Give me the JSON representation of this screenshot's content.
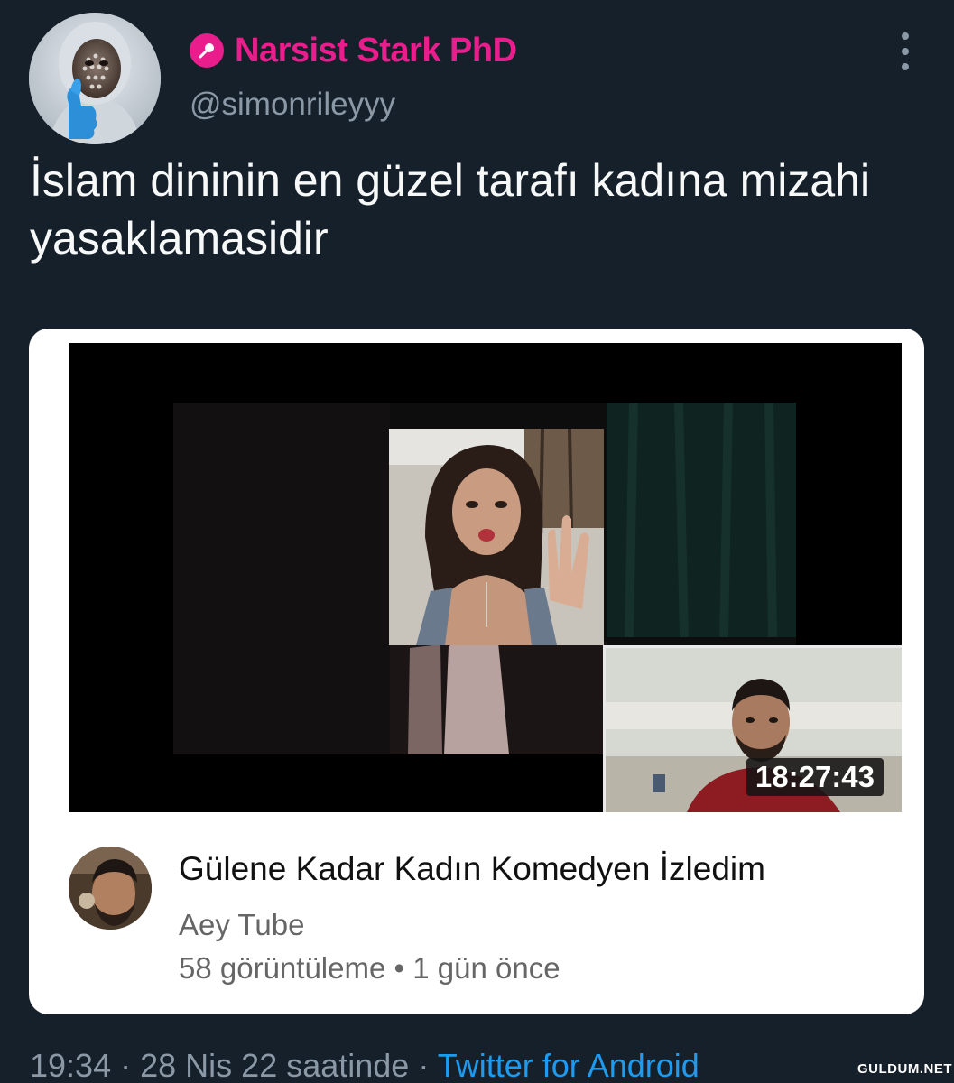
{
  "tweet": {
    "author": {
      "display_name": "Narsist Stark PhD",
      "handle": "@simonrileyyy",
      "avatar_icon": "masked-person-thumbs-up-avatar",
      "badge_icon": "pin-badge-icon"
    },
    "more_icon": "more-vertical-icon",
    "text": "İslam dininin en güzel tarafı kadına mizahi yasaklamasidir",
    "footer": {
      "time": "19:34",
      "date": "28 Nis 22 saatinde",
      "separator": "·",
      "source": "Twitter for Android"
    }
  },
  "embedded_video_card": {
    "duration": "18:27:43",
    "title": "Gülene Kadar Kadın Komedyen İzledim",
    "channel": "Aey Tube",
    "views": "58 görüntüleme",
    "meta_separator": "•",
    "age": "1 gün önce"
  },
  "watermark": "GULDUM.NET",
  "colors": {
    "background": "#15202b",
    "display_name": "#e91e8c",
    "muted_text": "#8b98a5",
    "link": "#1d9bf0",
    "card_background": "#ffffff"
  }
}
